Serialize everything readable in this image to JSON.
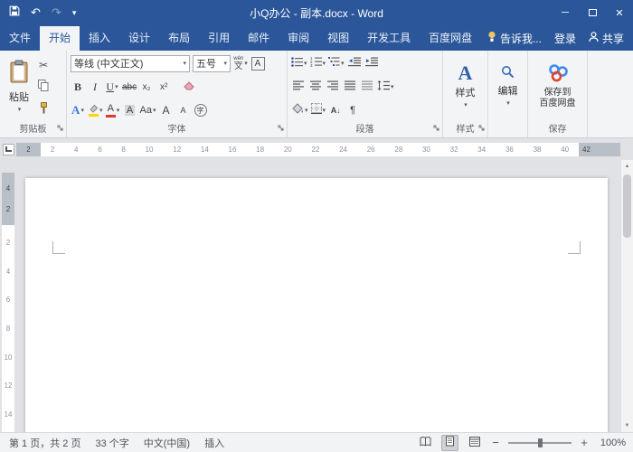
{
  "colors": {
    "accent": "#2b579a",
    "ribbon_bg": "#f3f4f6"
  },
  "titlebar": {
    "title": "小Q办公 - 副本.docx - Word"
  },
  "menu": {
    "file": "文件",
    "tabs": [
      "开始",
      "插入",
      "设计",
      "布局",
      "引用",
      "邮件",
      "审阅",
      "视图",
      "开发工具",
      "百度网盘"
    ],
    "active_tab": "开始",
    "tell_me": "告诉我...",
    "login": "登录",
    "share": "共享"
  },
  "icons": {
    "undo": "↶",
    "redo": "↷",
    "dropdown": "▾",
    "scissors": "✂",
    "pilcrow": "¶",
    "minimize": "─",
    "close": "✕",
    "zoom_out": "−",
    "zoom_in": "+",
    "scroll_up": "▲",
    "scroll_down": "▼"
  },
  "ribbon": {
    "clipboard": {
      "paste": "粘贴",
      "label": "剪贴板"
    },
    "font": {
      "label": "字体",
      "name": "等线 (中文正文)",
      "size": "五号",
      "phonetic_top": "wén",
      "phonetic_bottom": "文",
      "border_char": "A",
      "bold": "B",
      "italic": "I",
      "underline": "U",
      "strikethrough": "abc",
      "subscript": "x₂",
      "superscript": "x²",
      "text_effects": "A",
      "font_color": "A",
      "char_shading": "A",
      "change_case": "Aa",
      "grow_font": "A",
      "shrink_font": "A",
      "enclose_char": "字"
    },
    "paragraph": {
      "label": "段落",
      "sort": "A",
      "sort_arrow": "↓"
    },
    "styles": {
      "label": "样式",
      "button": "样式",
      "icon_letter": "A"
    },
    "editing": {
      "button": "编辑"
    },
    "save": {
      "label": "保存",
      "button_line1": "保存到",
      "button_line2": "百度网盘"
    }
  },
  "ruler": {
    "left_margin": "2",
    "numbers": [
      "2",
      "4",
      "6",
      "8",
      "10",
      "12",
      "14",
      "16",
      "18",
      "20",
      "22",
      "24",
      "26",
      "28",
      "30",
      "32",
      "34",
      "36",
      "38",
      "40"
    ],
    "right_margin": "42",
    "v_margin": [
      "4",
      "2"
    ],
    "v_numbers": [
      "2",
      "4",
      "6",
      "8",
      "10",
      "12",
      "14"
    ]
  },
  "statusbar": {
    "page_info": "第 1 页，共 2 页",
    "word_count": "33 个字",
    "language": "中文(中国)",
    "insert_mode": "插入",
    "zoom_level": "100%"
  }
}
